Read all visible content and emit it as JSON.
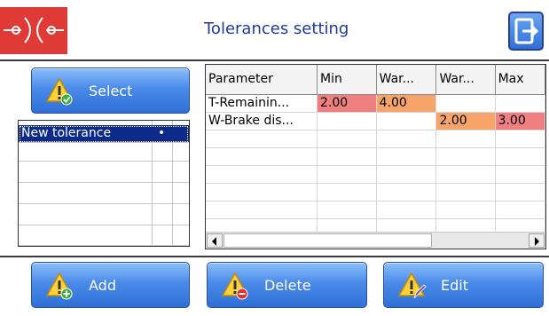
{
  "header": {
    "title": "Tolerances setting"
  },
  "icons": {
    "logo": "brand-logo",
    "exit": "exit-icon",
    "warning": "warning-triangle-icon"
  },
  "colors": {
    "accent": "#1f3a9a",
    "button": "#2f70d8",
    "low": "#f08080",
    "warn": "#f7a46b"
  },
  "select_button": {
    "label": "Select"
  },
  "tolerance_list": {
    "items": [
      {
        "label": "New tolerance",
        "marker": "•",
        "selected": true
      }
    ]
  },
  "grid": {
    "columns": [
      "Parameter",
      "Min",
      "War...",
      "War...",
      "Max"
    ],
    "rows": [
      [
        "T-Remainin...",
        "2.00",
        "4.00",
        "",
        ""
      ],
      [
        "W-Brake dis...",
        "",
        "",
        "2.00",
        "3.00"
      ]
    ]
  },
  "actions": {
    "add": "Add",
    "delete": "Delete",
    "edit": "Edit"
  }
}
